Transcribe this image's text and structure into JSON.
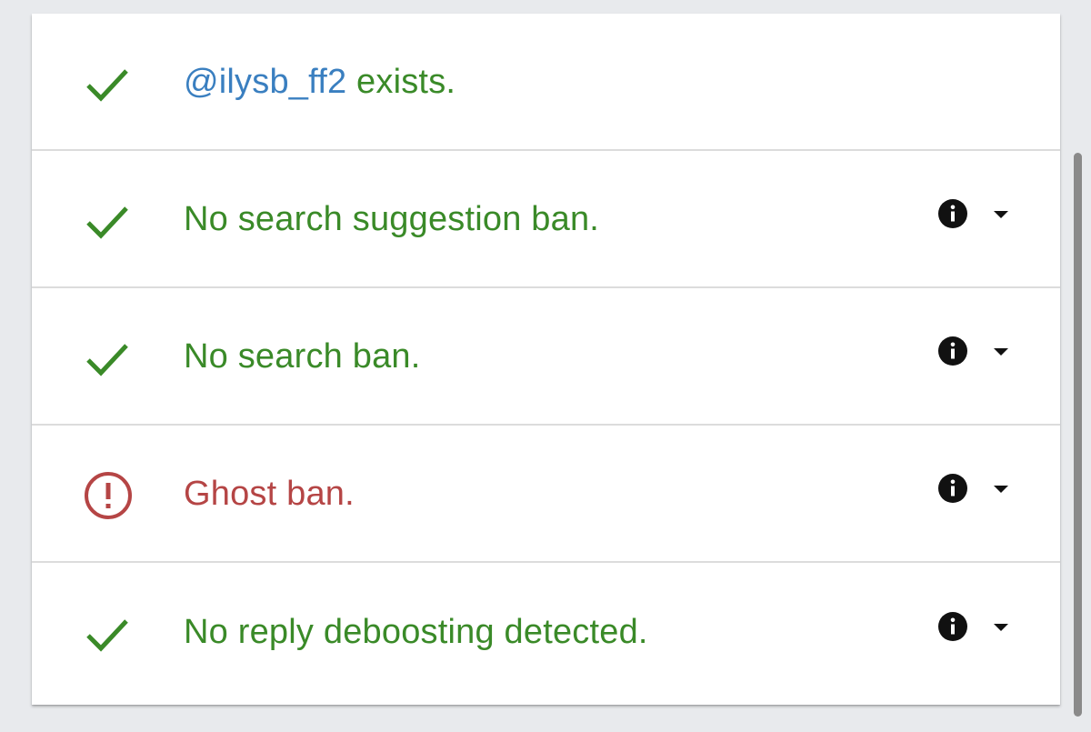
{
  "colors": {
    "success": "#3a8a28",
    "error": "#b54545",
    "handle": "#3a7fc0",
    "icon": "#111111",
    "background": "#e8eaed"
  },
  "rows": [
    {
      "status": "ok",
      "icon": "checkmark-icon",
      "handle": "@ilysb_ff2",
      "text": " exists.",
      "has_details": false
    },
    {
      "status": "ok",
      "icon": "checkmark-icon",
      "text": "No search suggestion ban.",
      "has_details": true,
      "info_icon": "info-icon",
      "toggle_icon": "caret-down-icon"
    },
    {
      "status": "ok",
      "icon": "checkmark-icon",
      "text": "No search ban.",
      "has_details": true,
      "info_icon": "info-icon",
      "toggle_icon": "caret-down-icon"
    },
    {
      "status": "error",
      "icon": "exclamation-circle-icon",
      "text": "Ghost ban.",
      "has_details": true,
      "info_icon": "info-icon",
      "toggle_icon": "caret-down-icon"
    },
    {
      "status": "ok",
      "icon": "checkmark-icon",
      "text": "No reply deboosting detected.",
      "has_details": true,
      "info_icon": "info-icon",
      "toggle_icon": "caret-down-icon"
    }
  ]
}
